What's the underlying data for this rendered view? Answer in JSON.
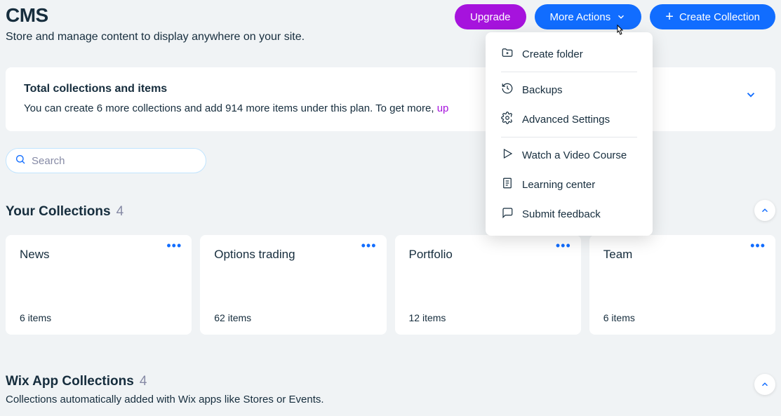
{
  "header": {
    "title": "CMS",
    "subtitle": "Store and manage content to display anywhere on your site.",
    "upgrade_label": "Upgrade",
    "more_actions_label": "More Actions",
    "create_collection_label": "Create Collection"
  },
  "info_card": {
    "title": "Total collections and items",
    "body_prefix": "You can create 6 more collections and add 914 more items under this plan. To get more, ",
    "body_link": "up"
  },
  "search": {
    "placeholder": "Search"
  },
  "dropdown": {
    "items": [
      {
        "label": "Create folder"
      },
      {
        "label": "Backups"
      },
      {
        "label": "Advanced Settings"
      },
      {
        "label": "Watch a Video Course"
      },
      {
        "label": "Learning center"
      },
      {
        "label": "Submit feedback"
      }
    ]
  },
  "your_collections": {
    "title": "Your Collections",
    "count": "4",
    "cards": [
      {
        "title": "News",
        "items": "6 items"
      },
      {
        "title": "Options trading",
        "items": "62 items"
      },
      {
        "title": "Portfolio",
        "items": "12 items"
      },
      {
        "title": "Team",
        "items": "6 items"
      }
    ]
  },
  "app_collections": {
    "title": "Wix App Collections",
    "count": "4",
    "subtitle": "Collections automatically added with Wix apps like Stores or Events."
  }
}
